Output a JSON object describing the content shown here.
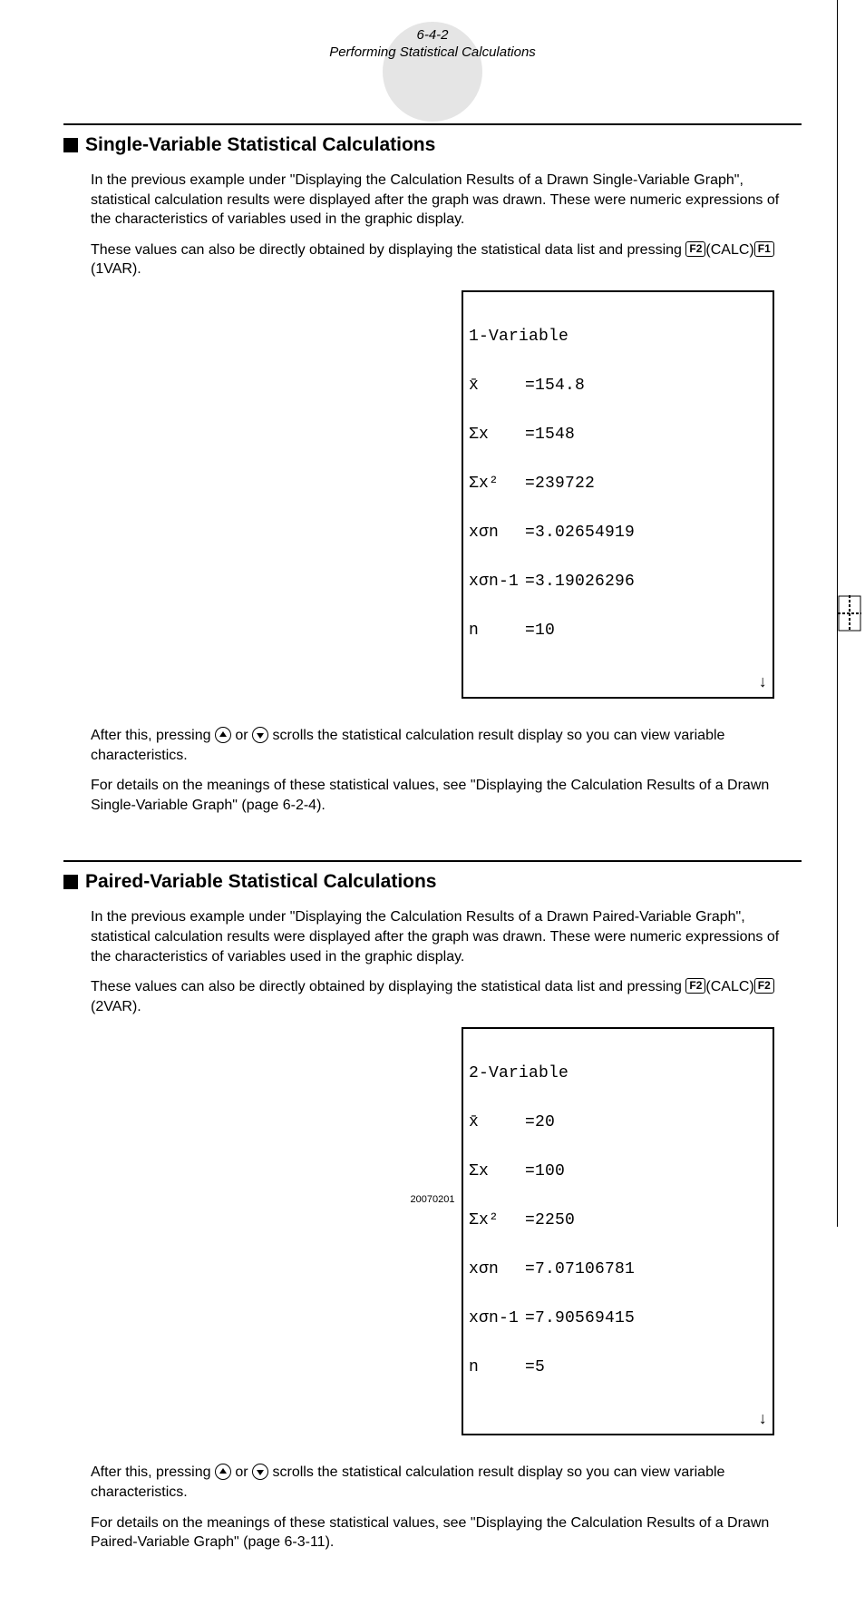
{
  "header": {
    "page_number": "6-4-2",
    "title": "Performing Statistical Calculations"
  },
  "section1": {
    "title": "Single-Variable Statistical Calculations",
    "para1": "In the previous example under \"Displaying the Calculation Results of a Drawn Single-Variable Graph\", statistical calculation results were displayed after the graph was drawn. These were numeric expressions of the characteristics of variables used in the graphic display.",
    "para2_pre": "These values can also be directly obtained by displaying the statistical data list and pressing ",
    "key1": "F2",
    "key1_after": "(CALC)",
    "key2": "F1",
    "key2_after": "(1VAR).",
    "para3_a": "After this, pressing ",
    "para3_b": " or ",
    "para3_c": " scrolls the statistical calculation result display so you can view variable characteristics.",
    "para4": "For details on the meanings of these statistical values, see \"Displaying the Calculation Results of a Drawn Single-Variable Graph\" (page 6-2-4).",
    "screen": {
      "title": "1-Variable",
      "rows": [
        {
          "label": "x̄",
          "value": "=154.8"
        },
        {
          "label": "Σx",
          "value": "=1548"
        },
        {
          "label": "Σx²",
          "value": "=239722"
        },
        {
          "label": "xσn",
          "value": "=3.02654919"
        },
        {
          "label": "xσn-1",
          "value": "=3.19026296"
        },
        {
          "label": "n",
          "value": "=10"
        }
      ],
      "scroll": "↓"
    }
  },
  "section2": {
    "title": "Paired-Variable Statistical Calculations",
    "para1": "In the previous example under \"Displaying the Calculation Results of a Drawn Paired-Variable Graph\", statistical calculation results were displayed after the graph was drawn. These were numeric expressions of the characteristics of variables used in the graphic display.",
    "para2_pre": "These values can also be directly obtained by displaying the statistical data list and pressing ",
    "key1": "F2",
    "key1_after": "(CALC)",
    "key2": "F2",
    "key2_after": "(2VAR).",
    "para3_a": "After this, pressing ",
    "para3_b": " or ",
    "para3_c": " scrolls the statistical calculation result display so you can view variable characteristics.",
    "para4": "For details on the meanings of these statistical values, see \"Displaying the Calculation Results of a Drawn Paired-Variable Graph\" (page 6-3-11).",
    "screen": {
      "title": "2-Variable",
      "rows": [
        {
          "label": "x̄",
          "value": "=20"
        },
        {
          "label": "Σx",
          "value": "=100"
        },
        {
          "label": "Σx²",
          "value": "=2250"
        },
        {
          "label": "xσn",
          "value": "=7.07106781"
        },
        {
          "label": "xσn-1",
          "value": "=7.90569415"
        },
        {
          "label": "n",
          "value": "=5"
        }
      ],
      "scroll": "↓"
    }
  },
  "footer": "20070201"
}
